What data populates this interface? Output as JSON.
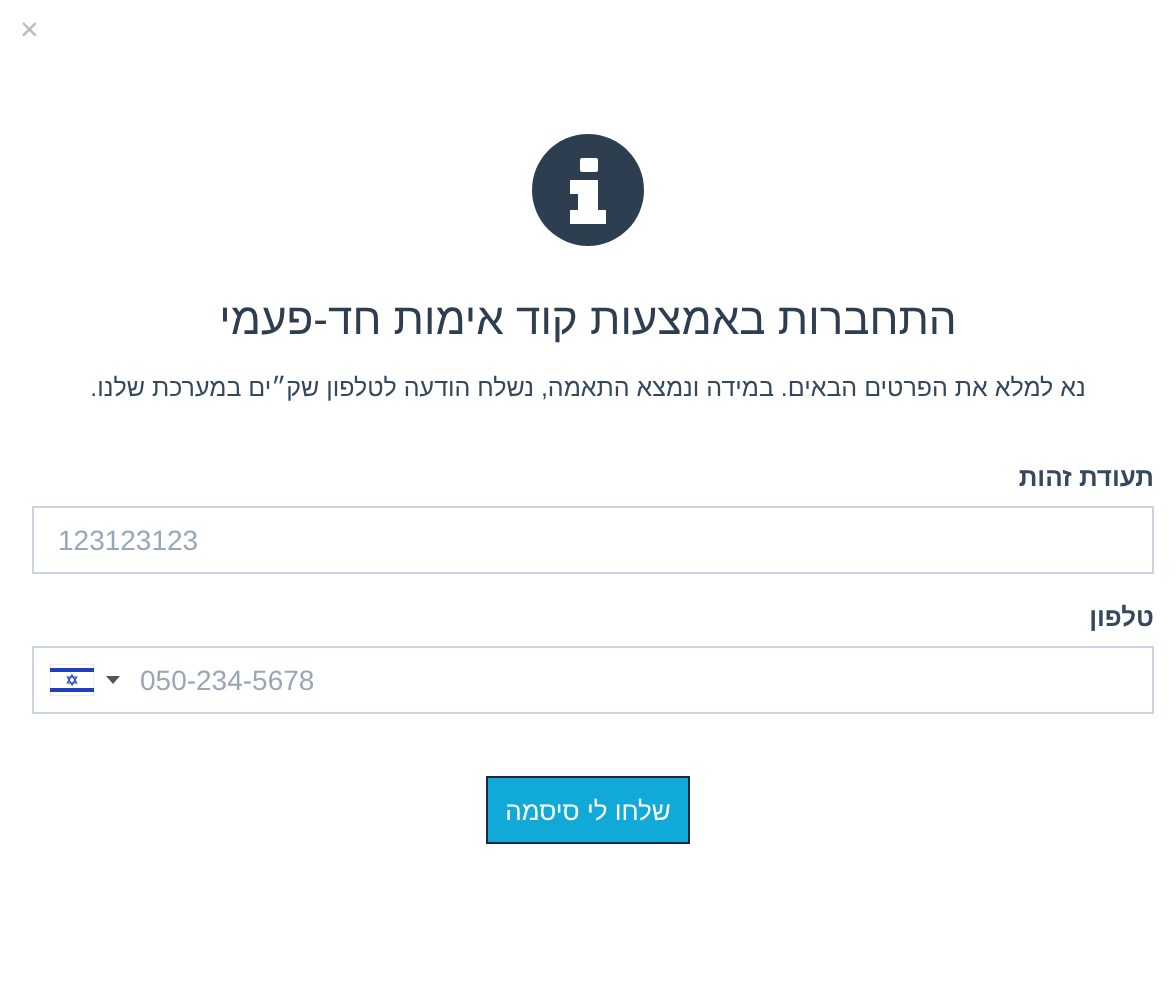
{
  "close": "×",
  "title": "התחברות באמצעות קוד אימות חד-פעמי",
  "subtitle": "נא למלא את הפרטים הבאים. במידה ונמצא התאמה, נשלח הודעה לטלפון שק״ים במערכת שלנו.",
  "fields": [
    {
      "kind": "text",
      "label": "תעודת זהות",
      "placeholder": "123123123"
    },
    {
      "kind": "phone",
      "label": "טלפון",
      "placeholder": "050-234-5678"
    }
  ],
  "submit": "שלחו לי סיסמה"
}
